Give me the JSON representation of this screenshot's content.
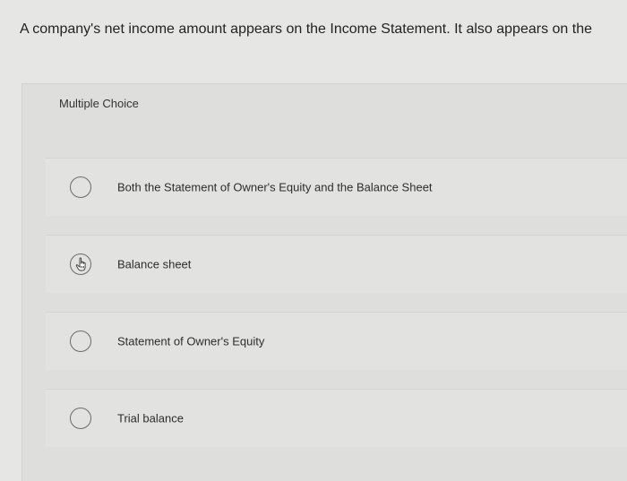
{
  "question": {
    "text": "A company's net income amount appears on the Income Statement. It also appears on the"
  },
  "multiple_choice": {
    "label": "Multiple Choice",
    "options": [
      {
        "label": "Both the Statement of Owner's Equity and the Balance Sheet",
        "selected": false,
        "icon": "radio-empty-icon"
      },
      {
        "label": "Balance sheet",
        "selected": false,
        "icon": "hand-pointer-icon"
      },
      {
        "label": "Statement of Owner's Equity",
        "selected": false,
        "icon": "radio-empty-icon"
      },
      {
        "label": "Trial balance",
        "selected": false,
        "icon": "radio-empty-icon"
      }
    ]
  },
  "colors": {
    "background": "#e6e6e4",
    "panel": "#dededc",
    "text": "#2b2b2b",
    "radio_border": "#6b6b6b"
  }
}
